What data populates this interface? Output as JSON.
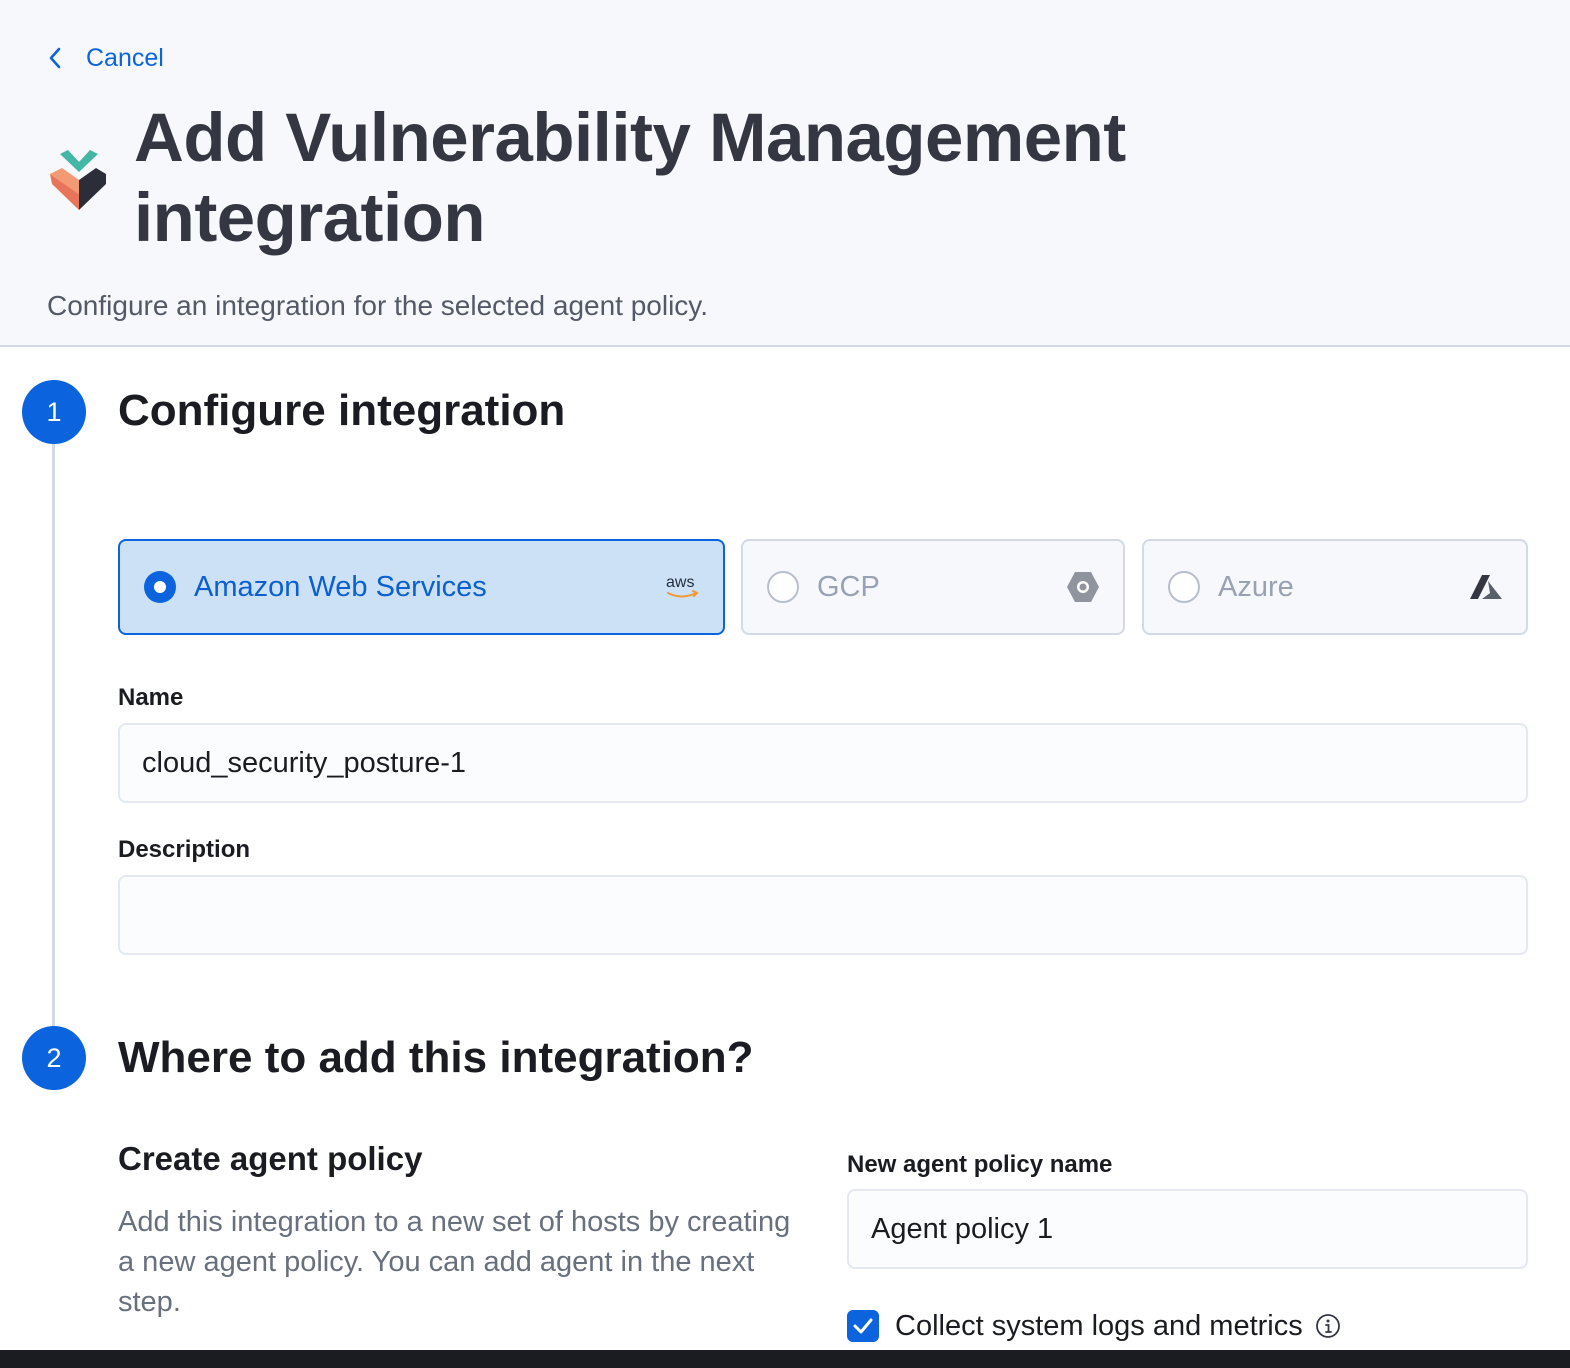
{
  "header": {
    "cancel_label": "Cancel",
    "title": "Add Vulnerability Management integration",
    "subtitle": "Configure an integration for the selected agent policy."
  },
  "steps": [
    {
      "number": "1",
      "title": "Configure integration"
    },
    {
      "number": "2",
      "title": "Where to add this integration?"
    }
  ],
  "providers": [
    {
      "label": "Amazon Web Services",
      "icon": "aws-icon",
      "selected": true
    },
    {
      "label": "GCP",
      "icon": "gcp-icon",
      "selected": false
    },
    {
      "label": "Azure",
      "icon": "azure-icon",
      "selected": false
    }
  ],
  "form": {
    "name_label": "Name",
    "name_value": "cloud_security_posture-1",
    "description_label": "Description",
    "description_value": ""
  },
  "agent_policy": {
    "heading": "Create agent policy",
    "description": "Add this integration to a new set of hosts by creating a new agent policy. You can add agent in the next step.",
    "name_label": "New agent policy name",
    "name_value": "Agent policy 1",
    "collect_label": "Collect system logs and metrics",
    "collect_checked": true
  },
  "colors": {
    "primary": "#0b64dd",
    "selected_bg": "#cce1f5",
    "header_bg": "#f7f8fc",
    "border": "#d3dae6"
  }
}
